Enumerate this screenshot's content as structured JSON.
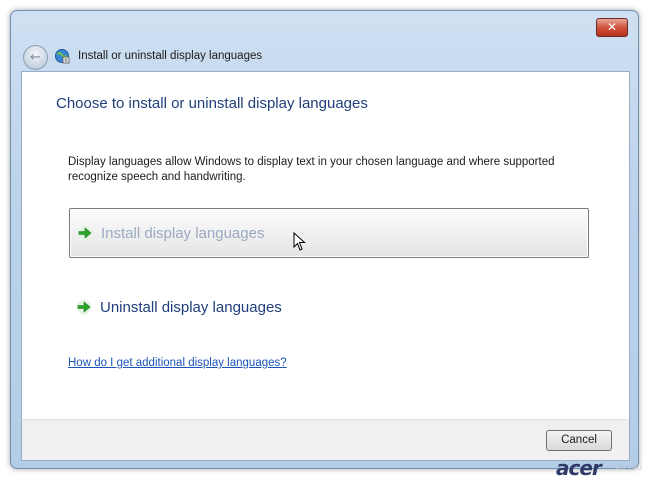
{
  "window": {
    "title": "Install or uninstall display languages",
    "close_glyph": "✕",
    "back_glyph": "←"
  },
  "content": {
    "heading": "Choose to install or uninstall display languages",
    "description": "Display languages allow Windows to display text in your chosen language and where supported recognize speech and handwriting.",
    "options": [
      {
        "label": "Install display languages",
        "icon": "green-arrow-icon",
        "state": "hover"
      },
      {
        "label": "Uninstall display languages",
        "icon": "green-arrow-icon",
        "state": "normal"
      }
    ],
    "help_link": "How do I get additional display languages?"
  },
  "footer": {
    "cancel_label": "Cancel"
  },
  "watermark": {
    "brand": "acer",
    "suffix": "FANS.RU"
  },
  "colors": {
    "heading": "#1f3e7a",
    "link": "#1c55b8",
    "arrow": "#2aa52a",
    "close": "#c8412c"
  }
}
